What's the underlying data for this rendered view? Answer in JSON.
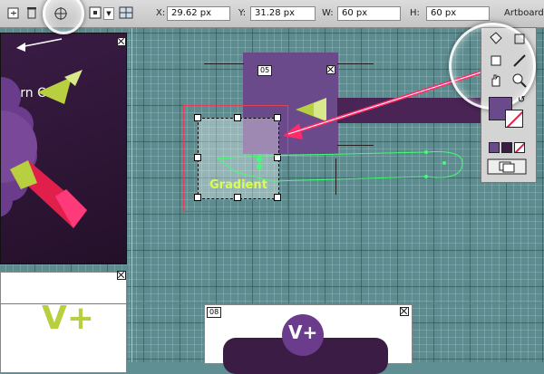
{
  "controlbar": {
    "x_label": "X:",
    "x_value": "29.62 px",
    "y_label": "Y:",
    "y_value": "31.28 px",
    "w_label": "W:",
    "w_value": "60 px",
    "h_label": "H:",
    "h_value": "60 px",
    "artboards_label": "Artboards"
  },
  "canvas": {
    "annotation": "Turn Off",
    "object_label": "Gradient",
    "artboard_05_number": "05",
    "artboard_08_number": "08",
    "artboard_logo_text": "V+",
    "artboard_logo_text_small": "V+"
  },
  "colors": {
    "artboard_purple": "#3a1c43",
    "artboard_violet": "#6a4a8a",
    "accent_green": "#b8d040",
    "accent_pink": "#e0204a",
    "selection_red": "#e0405a",
    "path_green": "#40ff70",
    "arrow_pink": "#ff2a6a"
  }
}
